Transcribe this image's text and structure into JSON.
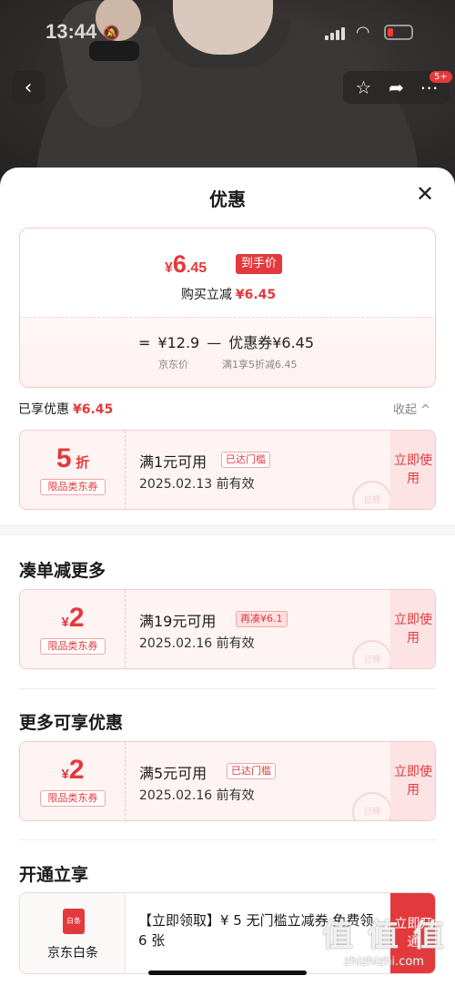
{
  "status_bar": {
    "time": "13:44"
  },
  "nav": {
    "badge": "5+"
  },
  "sheet": {
    "title": "优惠",
    "price": {
      "currency": "¥",
      "final_int": "6",
      "final_dec": ".45",
      "tag": "到手价",
      "instant_label": "购买立减",
      "instant_amount": "¥6.45",
      "eq": "=",
      "jd_price": "¥12.9",
      "minus": "—",
      "coupon_part": "优惠券¥6.45",
      "jd_price_label": "京东价",
      "coupon_rule": "满1享5折减6.45"
    },
    "enjoyed": {
      "label": "已享优惠",
      "amount": "¥6.45",
      "collapse": "收起 ^"
    },
    "coupons_enjoyed": [
      {
        "value": "5",
        "unit": "折",
        "kind": "限品类东券",
        "condition": "满1元可用",
        "chip": "已达门槛",
        "valid": "2025.02.13 前有效",
        "action": "立即使用",
        "stamp": "已领"
      }
    ],
    "more_section": {
      "title": "凑单减更多",
      "coupon": {
        "currency": "¥",
        "value": "2",
        "kind": "限品类东券",
        "condition": "满19元可用",
        "chip": "再凑¥6.1",
        "valid": "2025.02.16 前有效",
        "action": "立即使用",
        "stamp": "已领"
      }
    },
    "extra_section": {
      "title": "更多可享优惠",
      "coupon": {
        "currency": "¥",
        "value": "2",
        "kind": "限品类东券",
        "condition": "满5元可用",
        "chip": "已达门槛",
        "valid": "2025.02.16 前有效",
        "action": "立即使用",
        "stamp": "已领"
      }
    },
    "open_section": {
      "title": "开通立享",
      "card": {
        "logo_text": "白条",
        "name": "京东白条",
        "desc": "【立即领取】¥ 5 无门槛立减券 免费领 6 张",
        "action": "立即开通"
      }
    }
  },
  "watermark": {
    "text": "值 值 值",
    "url": "zhizhizhi.com"
  }
}
